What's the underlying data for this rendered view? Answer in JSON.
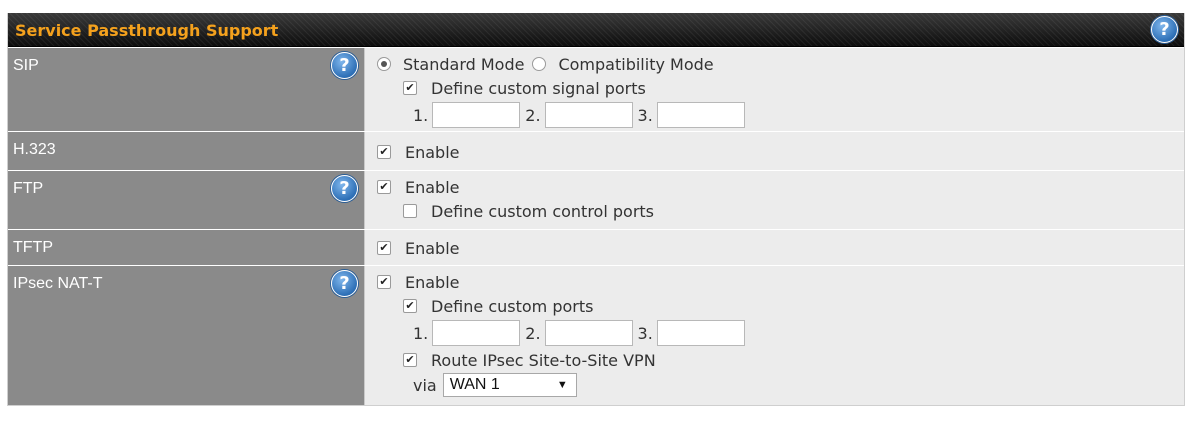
{
  "panel": {
    "title": "Service Passthrough Support"
  },
  "sip": {
    "label": "SIP",
    "standard_mode": "Standard Mode",
    "compat_mode": "Compatibility Mode",
    "define_ports": "Define custom signal ports",
    "port_labels": [
      "1.",
      "2.",
      "3."
    ],
    "port_values": [
      "",
      "",
      ""
    ]
  },
  "h323": {
    "label": "H.323",
    "enable": "Enable"
  },
  "ftp": {
    "label": "FTP",
    "enable": "Enable",
    "define_ports": "Define custom control ports"
  },
  "tftp": {
    "label": "TFTP",
    "enable": "Enable"
  },
  "ipsec": {
    "label": "IPsec NAT-T",
    "enable": "Enable",
    "define_ports": "Define custom ports",
    "port_labels": [
      "1.",
      "2.",
      "3."
    ],
    "port_values": [
      "",
      "",
      ""
    ],
    "route_label": "Route IPsec Site-to-Site VPN",
    "via_label": "via",
    "wan_selected": "WAN 1"
  },
  "icons": {
    "help": "help-icon",
    "check": "checkmark-icon",
    "dropdown": "dropdown-arrow-icon"
  },
  "colors": {
    "title": "#f4a11d",
    "label_bg": "#8a8a8a",
    "value_bg": "#ececec",
    "help": "#2d6fb6"
  }
}
